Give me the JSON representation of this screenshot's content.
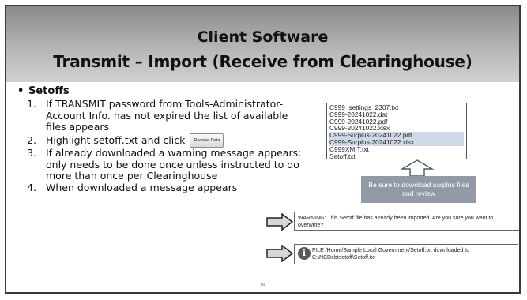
{
  "slide": {
    "title_line1": "Client Software",
    "title_line2": "Transmit – Import (Receive from Clearinghouse)",
    "page_number": "80"
  },
  "content": {
    "bullet": "Setoffs",
    "steps": [
      "If TRANSMIT password from Tools-Administrator-Account Info. has not expired the list of available files appears",
      "Highlight setoff.txt and click",
      "If already downloaded a warning message appears: only needs to be done once unless instructed to do more than once per Clearinghouse",
      "When downloaded a message appears"
    ],
    "receive_button_label": "Receive Data"
  },
  "file_list": {
    "files": [
      {
        "name": "C999_settings_2307.txt",
        "selected": false
      },
      {
        "name": "C999-20241022.dat",
        "selected": false
      },
      {
        "name": "C999-20241022.pdf",
        "selected": false
      },
      {
        "name": "C999-20241022.xlsx",
        "selected": false
      },
      {
        "name": "C999-Surplus-20241022.pdf",
        "selected": true
      },
      {
        "name": "C999-Surplus-20241022.xlsx",
        "selected": true
      },
      {
        "name": "C999XMIT.txt",
        "selected": false
      },
      {
        "name": "Setoff.txt",
        "selected": false
      }
    ]
  },
  "callout": {
    "text": "Be sure to download surplus files and review",
    "color": "#919aa6"
  },
  "warning_message": {
    "text": "WARNING: This Setoff file has already been imported. Are you sure you want to overwrite?"
  },
  "info_message": {
    "icon": "info-icon",
    "text": "FILE /Home/Sample Local Government/Setoff.txt downloaded to C:\\NCDebtsetoff\\Setoff.txt"
  }
}
